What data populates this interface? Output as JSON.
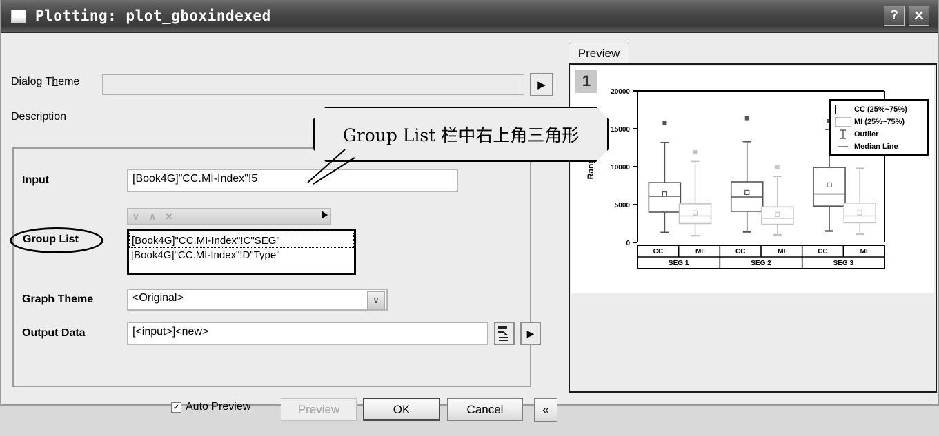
{
  "window": {
    "title": "Plotting: plot_gboxindexed",
    "icon": "window-icon",
    "help_label": "?",
    "close_label": "✕"
  },
  "dialog_theme": {
    "label": "Dialog Theme",
    "value": "",
    "placeholder": "",
    "arrow_label": "▶"
  },
  "description": {
    "label": "Description",
    "value": ""
  },
  "input": {
    "label": "Input",
    "value": "[Book4G]\"CC.MI-Index\"!5"
  },
  "group_list": {
    "label": "Group List",
    "toolbar": {
      "move_down": "∨",
      "move_up": "∧",
      "delete": "✕",
      "expand": "▶"
    },
    "items": [
      {
        "text": "[Book4G]\"CC.MI-Index\"!C\"SEG\"",
        "selected": true
      },
      {
        "text": "[Book4G]\"CC.MI-Index\"!D\"Type\"",
        "selected": false
      }
    ]
  },
  "graph_theme": {
    "label": "Graph Theme",
    "value": "<Original>",
    "arrow_label": "∨"
  },
  "output_data": {
    "label": "Output Data",
    "value": "[<input>]<new>",
    "pick_label": "select-data-icon",
    "arrow_label": "▶"
  },
  "footer": {
    "auto_preview_label": "Auto Preview",
    "auto_preview_checked": true,
    "check_glyph": "✓",
    "preview_label": "Preview",
    "preview_enabled": false,
    "ok_label": "OK",
    "cancel_label": "Cancel",
    "collapse_label": "«"
  },
  "preview": {
    "tab_label": "Preview",
    "layer_badge": "1"
  },
  "callout": {
    "text": "Group List 栏中右上角三角形"
  },
  "chart_data": {
    "type": "box",
    "title": "",
    "xlabel": "",
    "ylabel": "Range",
    "ylim": [
      0,
      20000
    ],
    "yticks": [
      0,
      5000,
      10000,
      15000,
      20000
    ],
    "ytick_labels": [
      "0",
      "5000",
      "10000",
      "15000",
      "20000"
    ],
    "grid": false,
    "legend_position": "top-right",
    "legend": [
      {
        "label": "CC (25%~75%)",
        "symbol": "box",
        "color": "#555555"
      },
      {
        "label": "MI (25%~75%)",
        "symbol": "box",
        "color": "#c0c0c0"
      },
      {
        "label": "Outlier",
        "symbol": "whisker",
        "color": "#777777"
      },
      {
        "label": "Median Line",
        "symbol": "line",
        "color": "#777777"
      }
    ],
    "group_labels": [
      "SEG 1",
      "SEG 2",
      "SEG 3"
    ],
    "category_labels": [
      "CC",
      "MI",
      "CC",
      "MI",
      "CC",
      "MI"
    ],
    "boxes": [
      {
        "group": "SEG 1",
        "series": "CC",
        "whisker_low": 1300,
        "q1": 4000,
        "median": 6100,
        "mean": 6400,
        "q3": 7900,
        "whisker_high": 13200,
        "outliers": [
          15800
        ]
      },
      {
        "group": "SEG 1",
        "series": "MI",
        "whisker_low": 900,
        "q1": 2500,
        "median": 3500,
        "mean": 3900,
        "q3": 5100,
        "whisker_high": 10700,
        "outliers": [
          11900
        ]
      },
      {
        "group": "SEG 2",
        "series": "CC",
        "whisker_low": 1400,
        "q1": 4100,
        "median": 6000,
        "mean": 6600,
        "q3": 8000,
        "whisker_high": 13300,
        "outliers": [
          16400
        ]
      },
      {
        "group": "SEG 2",
        "series": "MI",
        "whisker_low": 1000,
        "q1": 2400,
        "median": 3200,
        "mean": 3700,
        "q3": 4700,
        "whisker_high": 8700,
        "outliers": [
          9900
        ]
      },
      {
        "group": "SEG 3",
        "series": "CC",
        "whisker_low": 1500,
        "q1": 4800,
        "median": 6400,
        "mean": 7600,
        "q3": 9900,
        "whisker_high": 14900,
        "outliers": [
          16000
        ]
      },
      {
        "group": "SEG 3",
        "series": "MI",
        "whisker_low": 1100,
        "q1": 2600,
        "median": 3500,
        "mean": 3900,
        "q3": 5200,
        "whisker_high": 9800,
        "outliers": []
      }
    ]
  }
}
